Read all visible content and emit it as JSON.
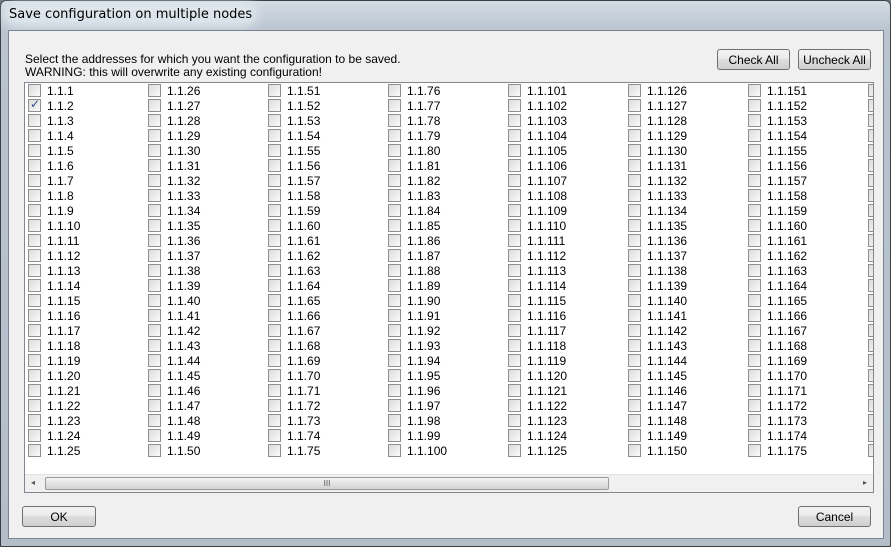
{
  "window": {
    "title": "Save configuration on multiple nodes"
  },
  "message": {
    "line1": "Select the addresses for which you want the configuration to be saved.",
    "line2": "WARNING: this will overwrite any existing configuration!"
  },
  "buttons": {
    "check_all": "Check All",
    "uncheck_all": "Uncheck All",
    "ok": "OK",
    "cancel": "Cancel"
  },
  "scrollbar": {
    "grip": "III",
    "left_arrow": "◂",
    "right_arrow": "▸"
  },
  "rows_per_column": 25,
  "checked": [
    "1.1.2"
  ],
  "items": [
    "1.1.1",
    "1.1.2",
    "1.1.3",
    "1.1.4",
    "1.1.5",
    "1.1.6",
    "1.1.7",
    "1.1.8",
    "1.1.9",
    "1.1.10",
    "1.1.11",
    "1.1.12",
    "1.1.13",
    "1.1.14",
    "1.1.15",
    "1.1.16",
    "1.1.17",
    "1.1.18",
    "1.1.19",
    "1.1.20",
    "1.1.21",
    "1.1.22",
    "1.1.23",
    "1.1.24",
    "1.1.25",
    "1.1.26",
    "1.1.27",
    "1.1.28",
    "1.1.29",
    "1.1.30",
    "1.1.31",
    "1.1.32",
    "1.1.33",
    "1.1.34",
    "1.1.35",
    "1.1.36",
    "1.1.37",
    "1.1.38",
    "1.1.39",
    "1.1.40",
    "1.1.41",
    "1.1.42",
    "1.1.43",
    "1.1.44",
    "1.1.45",
    "1.1.46",
    "1.1.47",
    "1.1.48",
    "1.1.49",
    "1.1.50",
    "1.1.51",
    "1.1.52",
    "1.1.53",
    "1.1.54",
    "1.1.55",
    "1.1.56",
    "1.1.57",
    "1.1.58",
    "1.1.59",
    "1.1.60",
    "1.1.61",
    "1.1.62",
    "1.1.63",
    "1.1.64",
    "1.1.65",
    "1.1.66",
    "1.1.67",
    "1.1.68",
    "1.1.69",
    "1.1.70",
    "1.1.71",
    "1.1.72",
    "1.1.73",
    "1.1.74",
    "1.1.75",
    "1.1.76",
    "1.1.77",
    "1.1.78",
    "1.1.79",
    "1.1.80",
    "1.1.81",
    "1.1.82",
    "1.1.83",
    "1.1.84",
    "1.1.85",
    "1.1.86",
    "1.1.87",
    "1.1.88",
    "1.1.89",
    "1.1.90",
    "1.1.91",
    "1.1.92",
    "1.1.93",
    "1.1.94",
    "1.1.95",
    "1.1.96",
    "1.1.97",
    "1.1.98",
    "1.1.99",
    "1.1.100",
    "1.1.101",
    "1.1.102",
    "1.1.103",
    "1.1.104",
    "1.1.105",
    "1.1.106",
    "1.1.107",
    "1.1.108",
    "1.1.109",
    "1.1.110",
    "1.1.111",
    "1.1.112",
    "1.1.113",
    "1.1.114",
    "1.1.115",
    "1.1.116",
    "1.1.117",
    "1.1.118",
    "1.1.119",
    "1.1.120",
    "1.1.121",
    "1.1.122",
    "1.1.123",
    "1.1.124",
    "1.1.125",
    "1.1.126",
    "1.1.127",
    "1.1.128",
    "1.1.129",
    "1.1.130",
    "1.1.131",
    "1.1.132",
    "1.1.133",
    "1.1.134",
    "1.1.135",
    "1.1.136",
    "1.1.137",
    "1.1.138",
    "1.1.139",
    "1.1.140",
    "1.1.141",
    "1.1.142",
    "1.1.143",
    "1.1.144",
    "1.1.145",
    "1.1.146",
    "1.1.147",
    "1.1.148",
    "1.1.149",
    "1.1.150",
    "1.1.151",
    "1.1.152",
    "1.1.153",
    "1.1.154",
    "1.1.155",
    "1.1.156",
    "1.1.157",
    "1.1.158",
    "1.1.159",
    "1.1.160",
    "1.1.161",
    "1.1.162",
    "1.1.163",
    "1.1.164",
    "1.1.165",
    "1.1.166",
    "1.1.167",
    "1.1.168",
    "1.1.169",
    "1.1.170",
    "1.1.171",
    "1.1.172",
    "1.1.173",
    "1.1.174",
    "1.1.175"
  ]
}
